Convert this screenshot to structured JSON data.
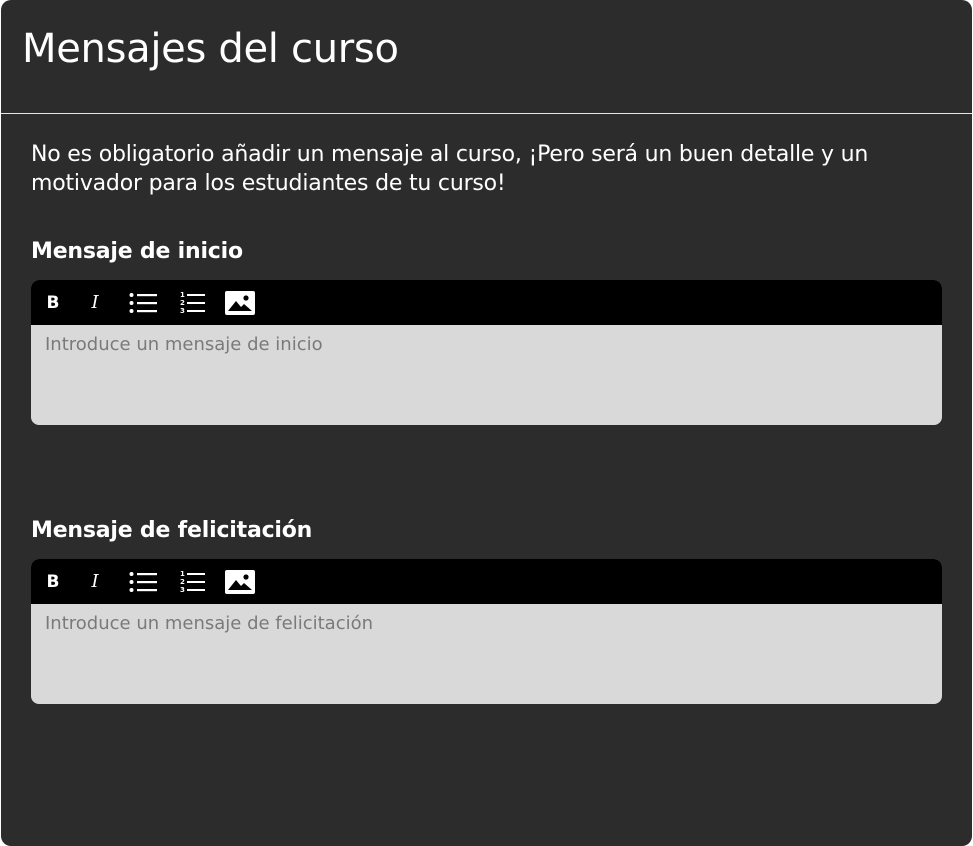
{
  "panel": {
    "title": "Mensajes del curso",
    "intro": "No es obligatorio añadir un mensaje al curso, ¡Pero será un buen detalle y un motivador para los estudiantes de tu curso!"
  },
  "toolbar": {
    "bold_label": "B",
    "italic_label": "I",
    "icons": [
      "bold-icon",
      "italic-icon",
      "bulleted-list-icon",
      "numbered-list-icon",
      "image-icon"
    ]
  },
  "sections": [
    {
      "label": "Mensaje de inicio",
      "placeholder": "Introduce un mensaje de inicio"
    },
    {
      "label": "Mensaje de felicitación",
      "placeholder": "Introduce un mensaje de felicitación"
    }
  ],
  "colors": {
    "panel_bg": "#2c2c2c",
    "toolbar_bg": "#000000",
    "editor_bg": "#d9d9d9",
    "placeholder_text": "#7a7a7a",
    "text": "#ffffff"
  }
}
